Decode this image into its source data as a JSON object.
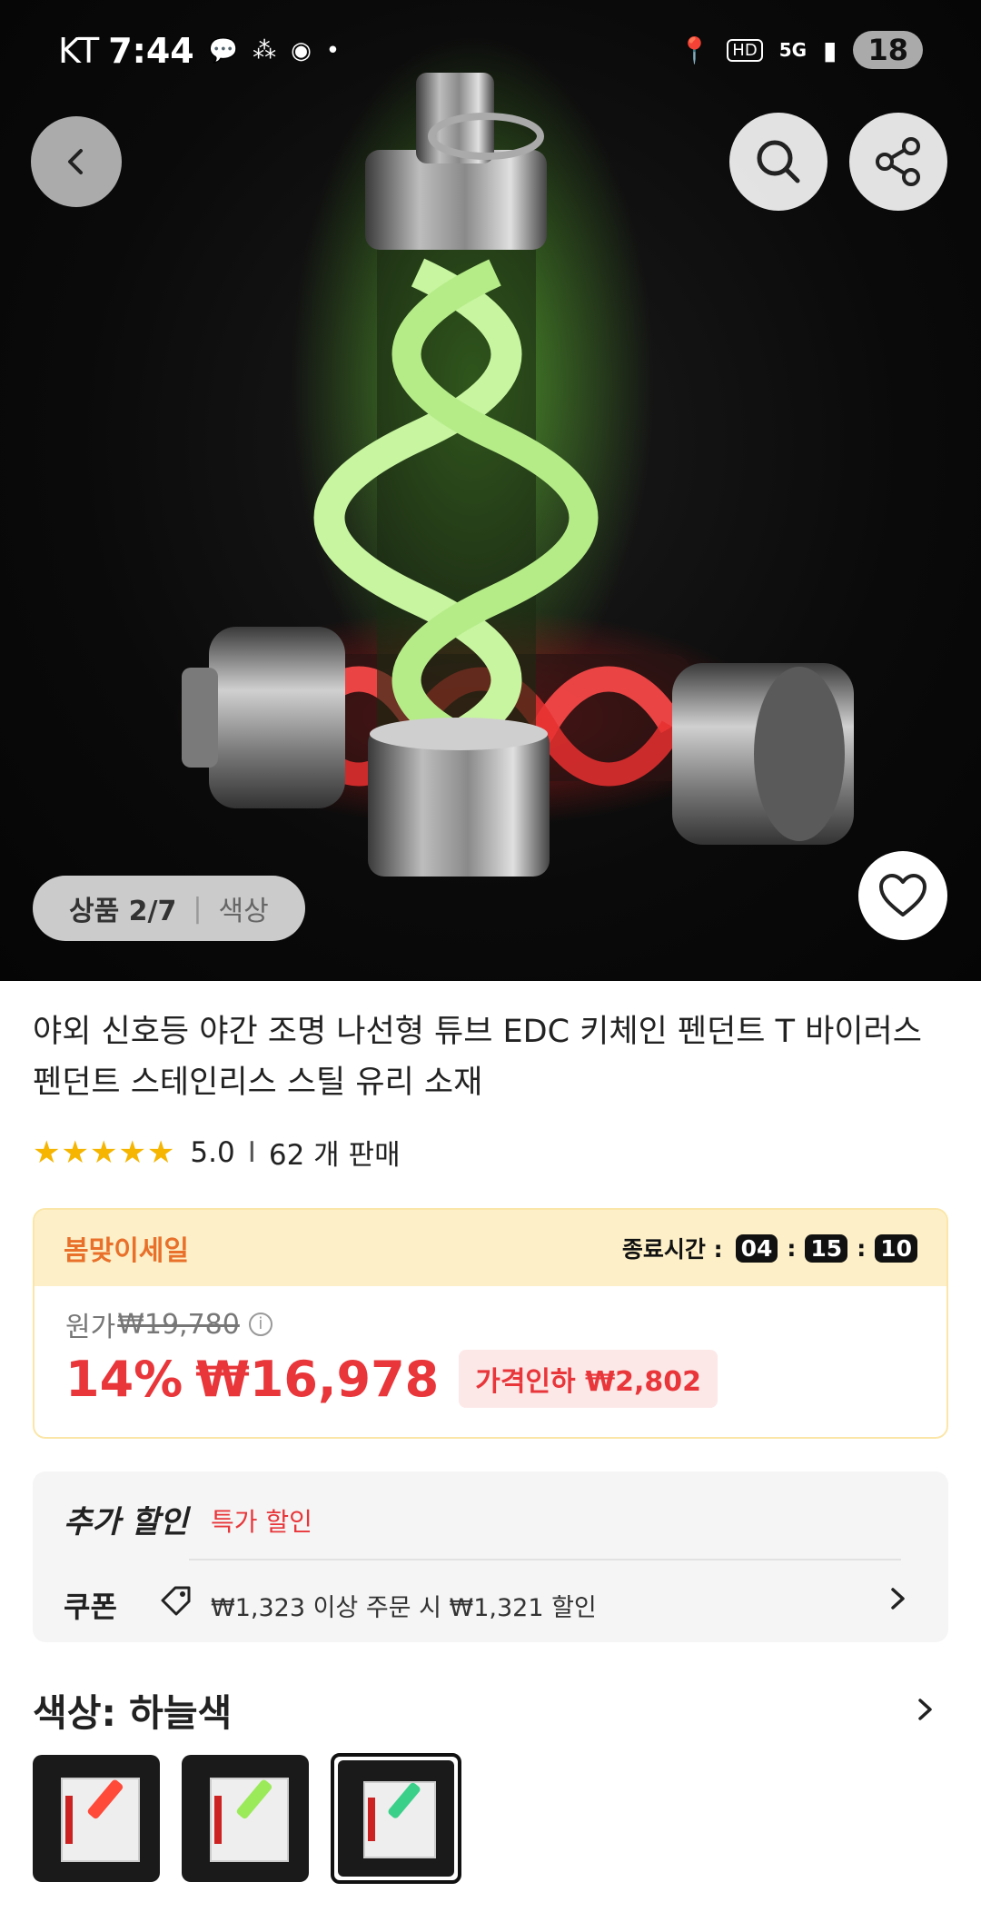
{
  "status_bar": {
    "carrier": "KT",
    "time": "7:44",
    "battery": "18"
  },
  "gallery": {
    "counter_label": "상품 2/7",
    "option_label": "색상"
  },
  "product": {
    "title": "야외 신호등 야간 조명 나선형 튜브 EDC 키체인 펜던트 T 바이러스 펜던트 스테인리스 스틸 유리 소재",
    "rating": "5.0",
    "separator": "I",
    "sold": "62 개 판매"
  },
  "sale": {
    "name": "봄맞이세일",
    "timer_label": "종료시간 :",
    "hours": "04",
    "minutes": "15",
    "seconds": "10",
    "original_label": "원가",
    "original_price": "₩19,780",
    "discount": "14%",
    "price": "₩16,978",
    "price_cut": "가격인하 ₩2,802"
  },
  "extra_discount": {
    "title": "추가 할인",
    "tag": "특가 할인",
    "coupon_label": "쿠폰",
    "coupon_text": "₩1,323 이상 주문 시 ₩1,321 할인"
  },
  "color": {
    "title": "색상: 하늘색",
    "selected_index": 2
  },
  "colors": {
    "accent_red": "#e8363a",
    "sale_orange": "#e8702a",
    "star": "#f5b500",
    "tube_green": "#c8f5a0",
    "tube_red": "#ff3b3b"
  }
}
